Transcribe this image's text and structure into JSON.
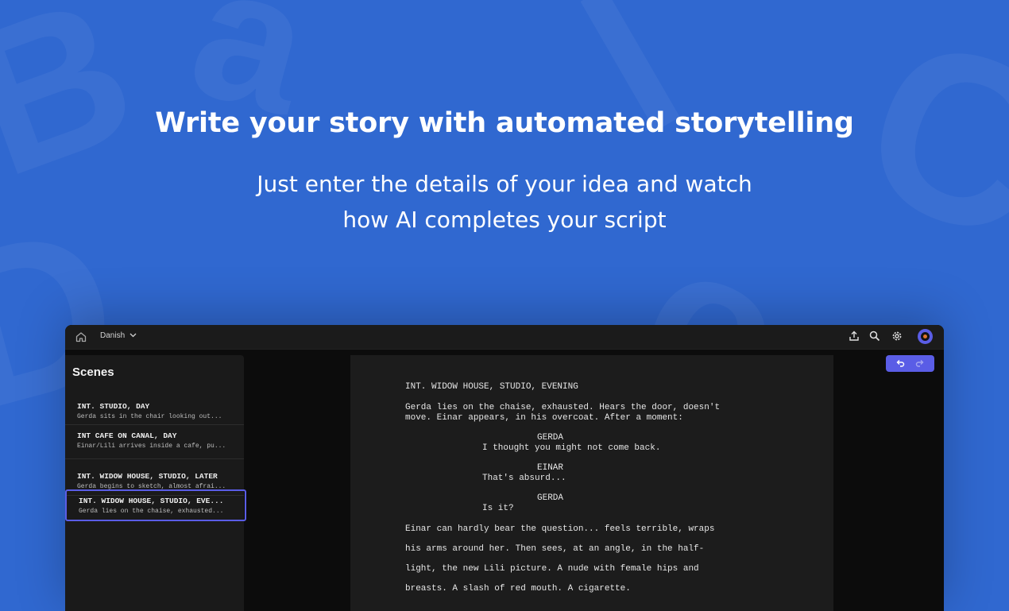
{
  "hero": {
    "headline": "Write your story with automated storytelling",
    "sub_line1": "Just enter the details of your idea and watch",
    "sub_line2": "how AI completes your script"
  },
  "topbar": {
    "language": "Danish",
    "icons": [
      "home-icon",
      "chevron-down-icon",
      "upload-icon",
      "search-icon",
      "gear-icon",
      "avatar"
    ]
  },
  "sidebar": {
    "title": "Scenes",
    "scenes": [
      {
        "heading": "INT. STUDIO, DAY",
        "summary": "Gerda sits in the chair looking out..."
      },
      {
        "heading": "INT CAFE ON CANAL, DAY",
        "summary": "Einar/Lili arrives inside a cafe, pu..."
      },
      {
        "heading": "INT. WIDOW HOUSE, STUDIO, LATER",
        "summary": "Gerda begins to sketch, almost afrai..."
      },
      {
        "heading": "INT. WIDOW HOUSE, STUDIO, EVE...",
        "summary": "Gerda lies on the chaise, exhausted..."
      }
    ],
    "active_index": 3
  },
  "script": {
    "scene_heading": "INT. WIDOW HOUSE, STUDIO, EVENING",
    "action1_line1": "Gerda lies on the chaise, exhausted. Hears the door, doesn't",
    "action1_line2": "move. Einar appears, in his overcoat. After a moment:",
    "char1": "GERDA",
    "dialog1": "I thought you might not come back.",
    "char2": "EINAR",
    "dialog2": "That's absurd...",
    "char3": "GERDA",
    "dialog3": "Is it?",
    "action2_line1": "Einar can hardly bear the question... feels terrible, wraps",
    "action2_line2": "his arms around her. Then sees, at an angle, in the half-",
    "action2_line3": "light, the new Lili picture. A nude with female hips and",
    "action2_line4": "breasts. A slash of red mouth. A cigarette."
  },
  "toolbar": {
    "undo_icon": "undo-icon",
    "redo_icon": "redo-icon"
  },
  "colors": {
    "background": "#3068d0",
    "accent": "#5a5de6",
    "panel": "#1a1a1a",
    "app_bg": "#0c0c0c"
  }
}
